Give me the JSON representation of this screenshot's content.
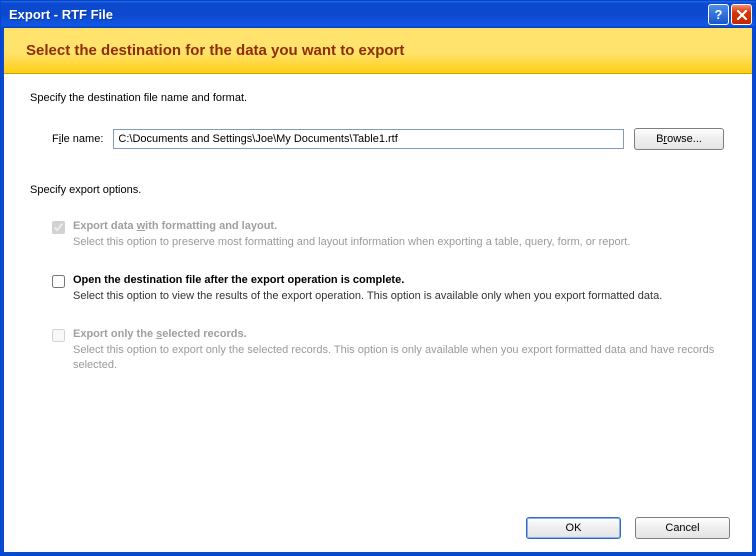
{
  "titlebar": {
    "title": "Export - RTF File"
  },
  "header": {
    "heading": "Select the destination for the data you want to export"
  },
  "dest": {
    "section_label": "Specify the destination file name and format.",
    "filename_prefix": "F",
    "filename_underlined": "i",
    "filename_suffix": "le name:",
    "filename_value": "C:\\Documents and Settings\\Joe\\My Documents\\Table1.rtf",
    "browse_prefix": "B",
    "browse_underlined": "r",
    "browse_suffix": "owse..."
  },
  "options": {
    "section_label": "Specify export options.",
    "opt1": {
      "prefix": "Export data ",
      "underlined": "w",
      "suffix": "ith formatting and layout.",
      "desc": "Select this option to preserve most formatting and layout information when exporting a table, query, form, or report."
    },
    "opt2": {
      "label": "Open the destination file after the export operation is complete.",
      "desc": "Select this option to view the results of the export operation. This option is available only when you export formatted data."
    },
    "opt3": {
      "prefix": "Export only the ",
      "underlined": "s",
      "suffix": "elected records.",
      "desc": "Select this option to export only the selected records. This option is only available when you export formatted data and have records selected."
    }
  },
  "footer": {
    "ok": "OK",
    "cancel": "Cancel"
  }
}
